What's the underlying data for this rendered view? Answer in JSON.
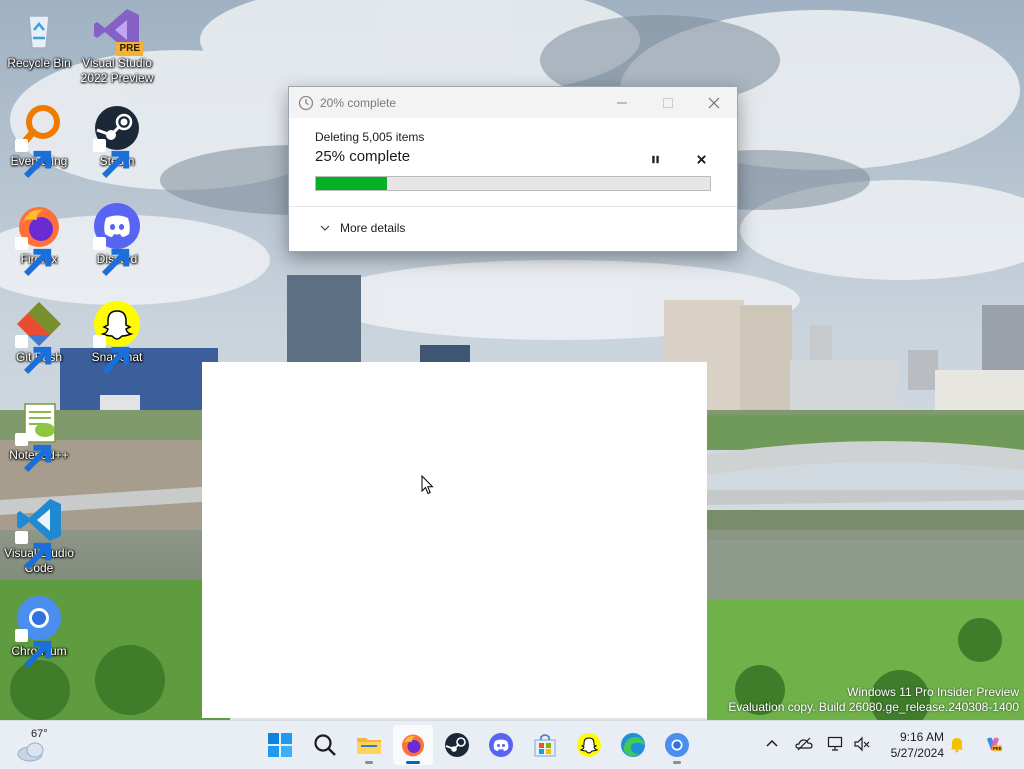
{
  "desktop": {
    "icons": [
      {
        "label": "Recycle Bin",
        "icon": "recycle-bin-icon"
      },
      {
        "label": "Visual Studio 2022 Preview",
        "label_line1": "Visual Studio",
        "label_line2": "2022 Preview",
        "icon": "visual-studio-icon",
        "badge": "PRE"
      },
      {
        "label": "Everything",
        "icon": "everything-search-icon"
      },
      {
        "label": "Steam",
        "icon": "steam-icon"
      },
      {
        "label": "Firefox",
        "icon": "firefox-icon"
      },
      {
        "label": "Discord",
        "icon": "discord-icon"
      },
      {
        "label": "Git Bash",
        "icon": "git-bash-icon"
      },
      {
        "label": "Snapchat",
        "icon": "snapchat-icon"
      },
      {
        "label": "Notepad++",
        "icon": "notepad-plus-plus-icon"
      },
      {
        "label": "Visual Studio Code",
        "label_line1": "Visual Studio",
        "label_line2": "Code",
        "icon": "vscode-icon"
      },
      {
        "label": "Chromium",
        "icon": "chromium-icon"
      }
    ]
  },
  "dialog": {
    "title": "20% complete",
    "operation": "Deleting 5,005 items",
    "percent_text": "25% complete",
    "progress": 0.18,
    "more_details": "More details",
    "accent": "#06b025"
  },
  "watermark": {
    "line1": "Windows 11 Pro Insider Preview",
    "line2": "Evaluation copy. Build 26080.ge_release.240308-1400"
  },
  "taskbar": {
    "weather_temp": "67°",
    "apps": [
      {
        "name": "start",
        "icon": "windows-start-icon"
      },
      {
        "name": "search",
        "icon": "search-icon"
      },
      {
        "name": "file-explorer",
        "icon": "file-explorer-icon"
      },
      {
        "name": "firefox",
        "icon": "firefox-icon"
      },
      {
        "name": "steam",
        "icon": "steam-icon"
      },
      {
        "name": "discord",
        "icon": "discord-icon"
      },
      {
        "name": "microsoft-store",
        "icon": "store-icon"
      },
      {
        "name": "snapchat",
        "icon": "snapchat-icon"
      },
      {
        "name": "edge",
        "icon": "edge-icon"
      },
      {
        "name": "chromium",
        "icon": "chromium-icon"
      }
    ],
    "time": "9:16 AM",
    "date": "5/27/2024"
  }
}
